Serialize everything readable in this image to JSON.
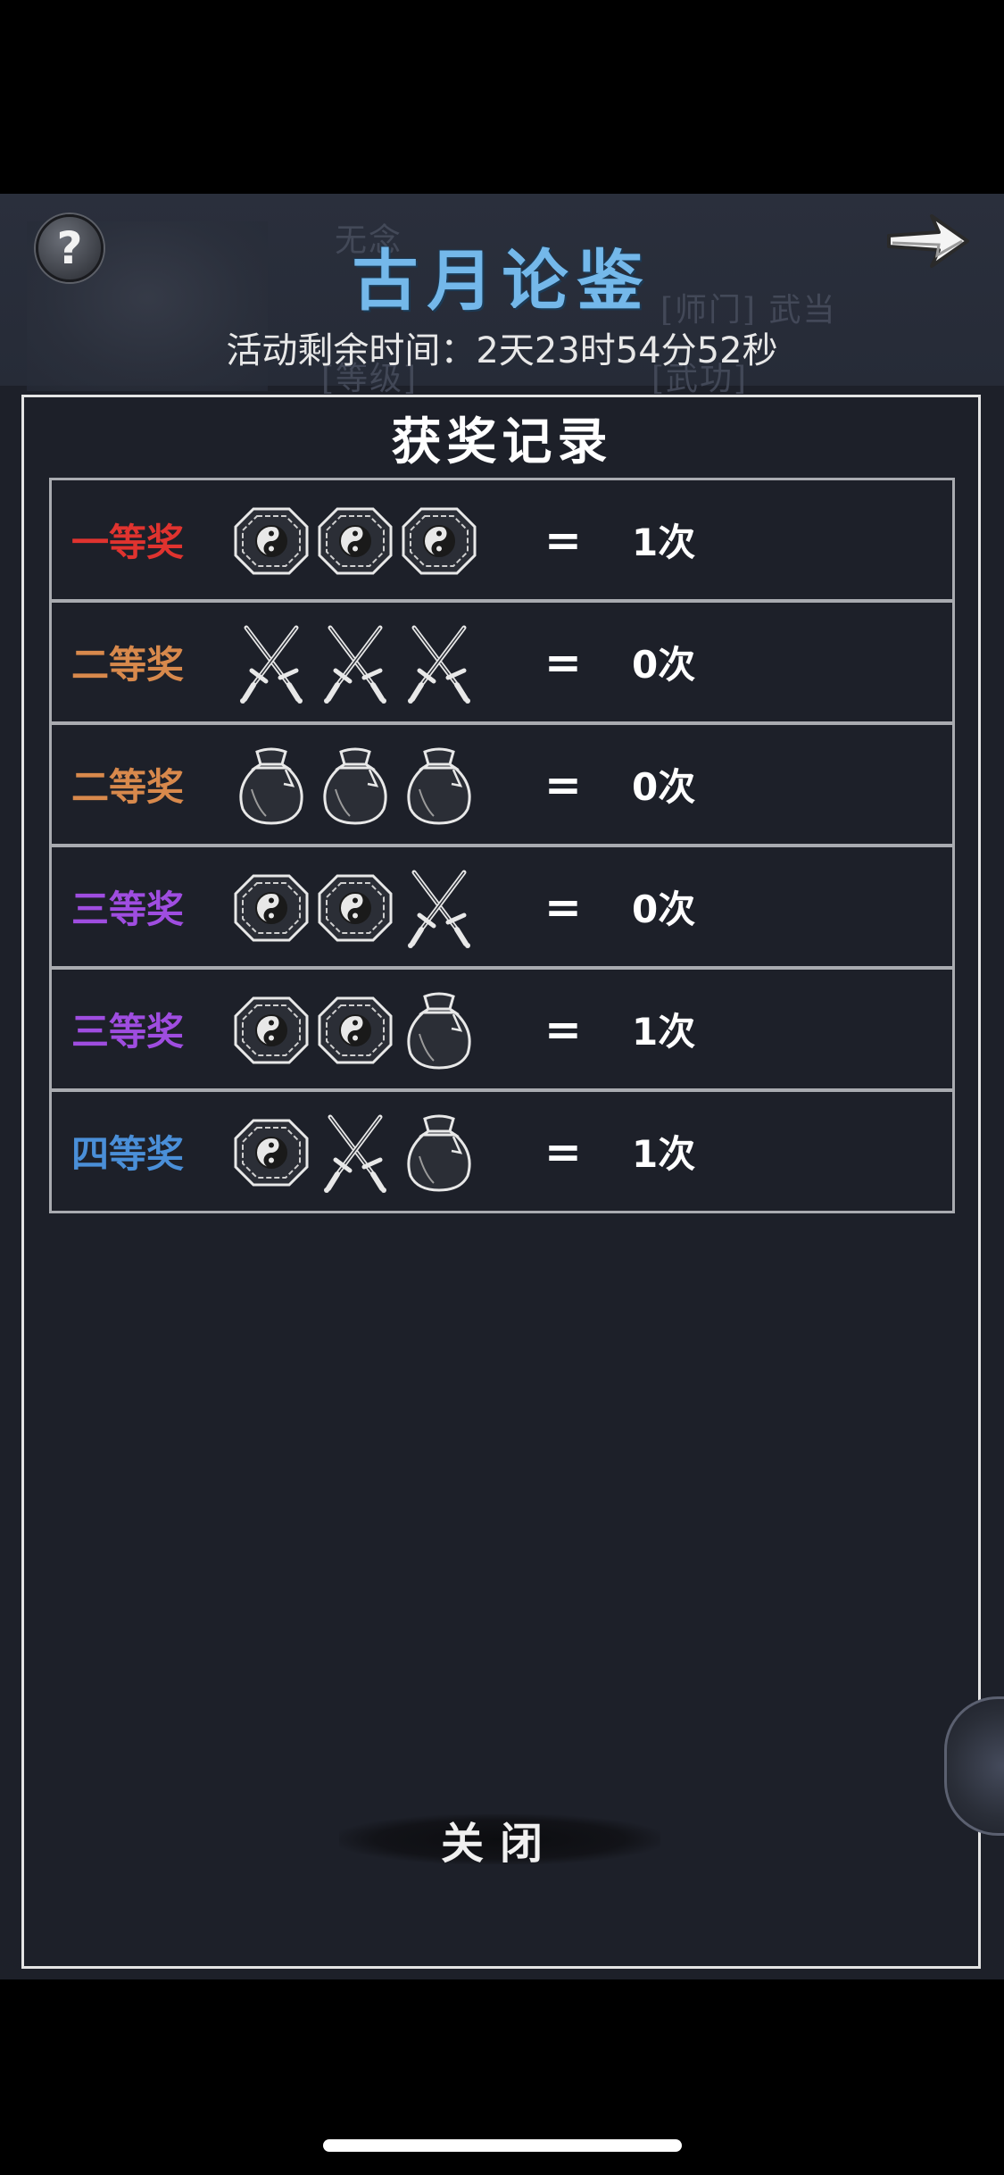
{
  "header": {
    "title": "古月论鉴",
    "timer": "活动剩余时间：2天23时54分52秒",
    "background_text": [
      "无念",
      "[师门] 武当",
      "[等级]",
      "[武功]"
    ]
  },
  "buttons": {
    "help_glyph": "?",
    "next_icon": "arrow-right-icon",
    "close_label": "关闭"
  },
  "panel": {
    "title": "获奖记录"
  },
  "prizes": [
    {
      "label": "一等奖",
      "color": "#e0332f",
      "icons": [
        "bagua-icon",
        "bagua-icon",
        "bagua-icon"
      ],
      "equals": "=",
      "count": "1次"
    },
    {
      "label": "二等奖",
      "color": "#d8894c",
      "icons": [
        "crossed-swords-icon",
        "crossed-swords-icon",
        "crossed-swords-icon"
      ],
      "equals": "=",
      "count": "0次"
    },
    {
      "label": "二等奖",
      "color": "#d8894c",
      "icons": [
        "pouch-icon",
        "pouch-icon",
        "pouch-icon"
      ],
      "equals": "=",
      "count": "0次"
    },
    {
      "label": "三等奖",
      "color": "#9f4de0",
      "icons": [
        "bagua-icon",
        "bagua-icon",
        "crossed-swords-icon"
      ],
      "equals": "=",
      "count": "0次"
    },
    {
      "label": "三等奖",
      "color": "#9f4de0",
      "icons": [
        "bagua-icon",
        "bagua-icon",
        "pouch-icon"
      ],
      "equals": "=",
      "count": "1次"
    },
    {
      "label": "四等奖",
      "color": "#4a8fd8",
      "icons": [
        "bagua-icon",
        "crossed-swords-icon",
        "pouch-icon"
      ],
      "equals": "=",
      "count": "1次"
    }
  ],
  "colors": {
    "title": "#74b8ea",
    "panel_bg": "#1d2029",
    "panel_border": "#e4e4e4",
    "row_border": "#a9abb0"
  }
}
